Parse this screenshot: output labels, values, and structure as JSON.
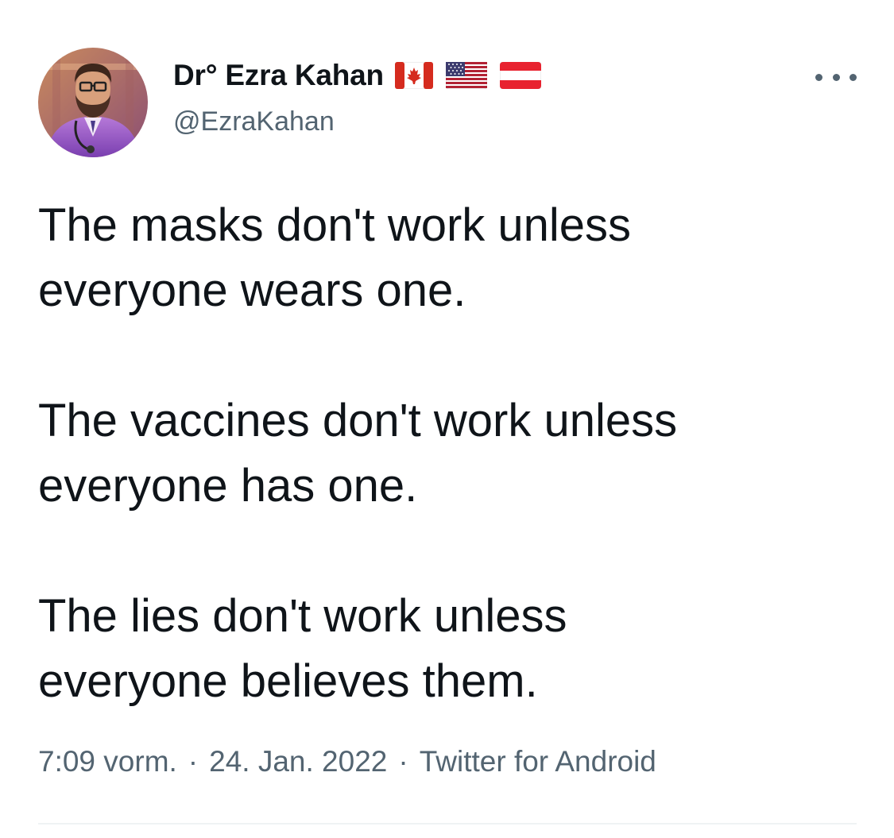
{
  "author": {
    "display_name": "Dr° Ezra Kahan",
    "handle": "@EzraKahan",
    "flags": [
      "canada-flag-icon",
      "us-flag-icon",
      "austria-flag-icon"
    ]
  },
  "more_icon": "ellipsis-icon",
  "tweet": {
    "paragraphs": [
      {
        "line1": "The masks don't work unless",
        "line2": "everyone wears one."
      },
      {
        "line1": "The vaccines don't work unless",
        "line2": "everyone has one."
      },
      {
        "line1": "The lies don't work unless",
        "line2": "everyone believes them."
      }
    ]
  },
  "meta": {
    "time": "7:09 vorm.",
    "separator": "·",
    "date": "24. Jan. 2022",
    "source": "Twitter for Android"
  },
  "colors": {
    "text": "#0f1419",
    "secondary": "#536471",
    "divider": "#eff3f4"
  }
}
